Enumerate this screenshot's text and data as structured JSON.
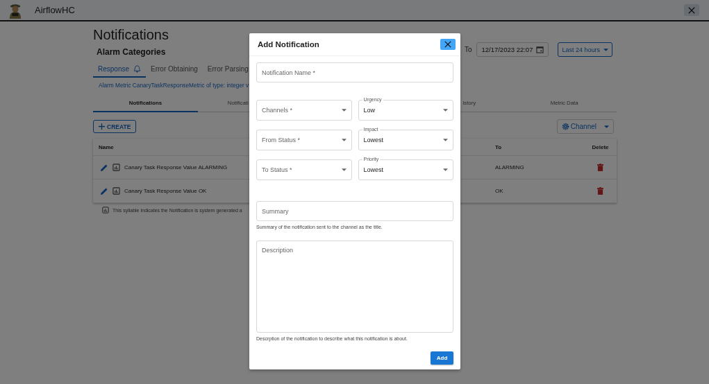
{
  "app_bar": {
    "title": "AirflowHC"
  },
  "page": {
    "title": "Notifications",
    "subtitle": "Alarm Categories",
    "range": {
      "to_label": "To",
      "to_value": "12/17/2023 22:07",
      "preset": "Last 24 hours"
    },
    "category_tabs": [
      {
        "label": "Response",
        "selected": true,
        "alarm": true
      },
      {
        "label": "Error Obtaining",
        "selected": false,
        "alarm": false
      },
      {
        "label": "Error Parsing",
        "selected": false,
        "alarm": false
      }
    ],
    "metric_link": "Alarm Metric CanaryTaskResponseMetric of type: integer v",
    "sub_tabs": [
      {
        "label": "Notifications",
        "selected": true,
        "kind": "full"
      },
      {
        "label": "Notificati",
        "selected": false,
        "kind": "cut-end"
      },
      {
        "label": "istory",
        "selected": false,
        "kind": "cut-start"
      },
      {
        "label": "Metric Data",
        "selected": false,
        "kind": "full"
      }
    ],
    "create_button": "CREATE",
    "channel_button": "Channel",
    "table": {
      "columns": [
        "Name",
        "To",
        "Delete"
      ],
      "rows": [
        {
          "name": "Canary Task Response Value ALARMING",
          "to": "ALARMING",
          "system": true
        },
        {
          "name": "Canary Task Response Value OK",
          "to": "OK",
          "system": true
        }
      ]
    },
    "footnote": "This syllable indicates the Notification is system generated a"
  },
  "dialog": {
    "title": "Add Notification",
    "name_field": {
      "placeholder": "Notification Name *"
    },
    "select_rows": [
      [
        {
          "placeholder": "Channels *"
        },
        {
          "label": "Urgency",
          "value": "Low"
        }
      ],
      [
        {
          "placeholder": "From Status *"
        },
        {
          "label": "Impact",
          "value": "Lowest"
        }
      ],
      [
        {
          "placeholder": "To Status *"
        },
        {
          "label": "Priority",
          "value": "Lowest"
        }
      ]
    ],
    "summary": {
      "placeholder": "Summary",
      "helper": "Summary of the notification sent to the channel as the title."
    },
    "description": {
      "placeholder": "Description",
      "helper": "Descrption of the notification to describe what this notification is about."
    },
    "submit": "Add"
  }
}
